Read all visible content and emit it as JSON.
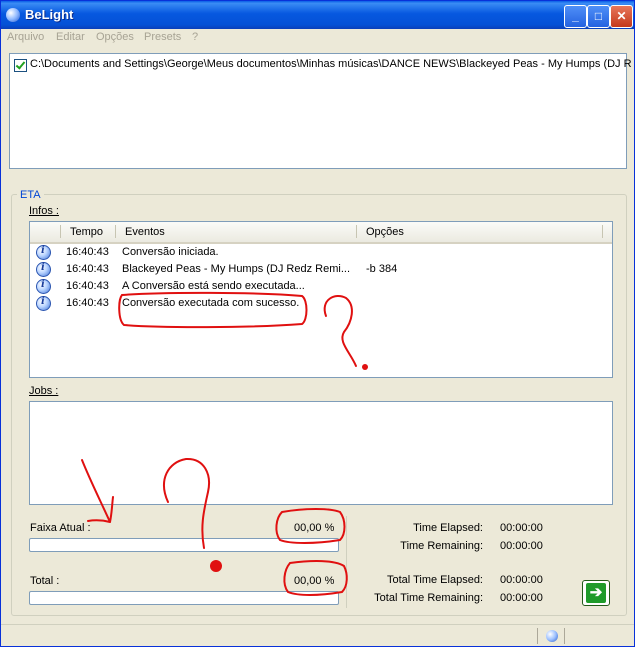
{
  "window": {
    "title": "BeLight",
    "icon": "app-globe-icon"
  },
  "menubar": {
    "items": [
      "Arquivo",
      "Editar",
      "Opções",
      "Presets",
      "?"
    ]
  },
  "files": [
    {
      "checked": true,
      "path": "C:\\Documents and Settings\\George\\Meus documentos\\Minhas músicas\\DANCE NEWS\\Blackeyed Peas - My Humps (DJ R"
    }
  ],
  "eta": {
    "group_label": "ETA",
    "infos_label": "Infos :",
    "columns": [
      "Tempo",
      "Eventos",
      "Opções"
    ],
    "rows": [
      {
        "icon": "info-icon",
        "time": "16:40:43",
        "event": "Conversão iniciada.",
        "options": ""
      },
      {
        "icon": "info-icon",
        "time": "16:40:43",
        "event": "Blackeyed Peas - My Humps (DJ Redz Remi...",
        "options": "-b 384"
      },
      {
        "icon": "info-icon",
        "time": "16:40:43",
        "event": "A Conversão está sendo executada...",
        "options": ""
      },
      {
        "icon": "info-icon",
        "time": "16:40:43",
        "event": "Conversão executada com sucesso.",
        "options": ""
      }
    ],
    "jobs_label": "Jobs :"
  },
  "progress": {
    "current": {
      "label": "Faixa Atual :",
      "percent_text": "00,00 %",
      "value": 0.0
    },
    "total": {
      "label": "Total :",
      "percent_text": "00,00 %",
      "value": 0.0
    }
  },
  "timing": {
    "time_elapsed_label": "Time Elapsed:",
    "time_elapsed": "00:00:00",
    "time_remaining_label": "Time Remaining:",
    "time_remaining": "00:00:00",
    "total_elapsed_label": "Total Time Elapsed:",
    "total_elapsed": "00:00:00",
    "total_remaining_label": "Total Time Remaining:",
    "total_remaining": "00:00:00"
  },
  "colors": {
    "title_bar": "#0758e0",
    "annotation_red": "#e01010",
    "go_button": "#1f9b2a",
    "group_label": "#0046d5"
  }
}
